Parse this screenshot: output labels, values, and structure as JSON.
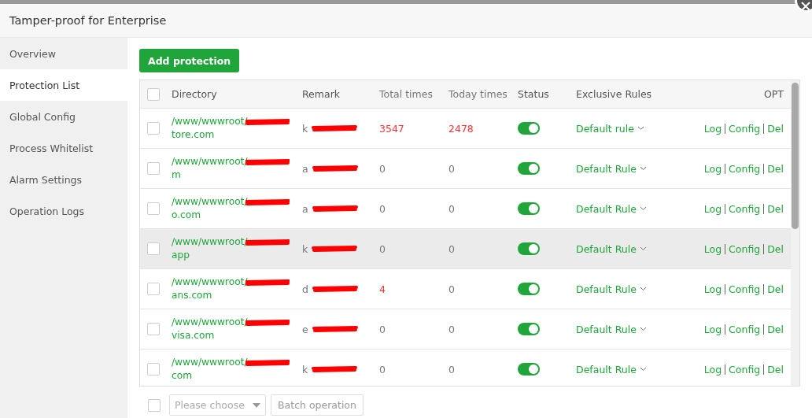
{
  "window": {
    "title": "Tamper-proof for Enterprise"
  },
  "sidebar": {
    "items": [
      {
        "label": "Overview",
        "selected": false
      },
      {
        "label": "Protection List",
        "selected": true
      },
      {
        "label": "Global Config",
        "selected": false
      },
      {
        "label": "Process Whitelist",
        "selected": false
      },
      {
        "label": "Alarm Settings",
        "selected": false
      },
      {
        "label": "Operation Logs",
        "selected": false
      }
    ]
  },
  "add_button": "Add protection",
  "table": {
    "all_checked": false,
    "columns": [
      "Directory",
      "Remark",
      "Total times",
      "Today times",
      "Status",
      "Exclusive Rules",
      "OPT"
    ],
    "rows": [
      {
        "dir_head": "/www/wwwroot/",
        "dir_tail": "tore.com",
        "remark_head": "k",
        "total": "3547",
        "total_alert": true,
        "today": "2478",
        "today_alert": true,
        "on": true,
        "rule": "Default rule",
        "actions": [
          "Log",
          "Config",
          "Del"
        ],
        "hovered": false,
        "checked": false
      },
      {
        "dir_head": "/www/wwwroot/",
        "dir_tail": "m",
        "remark_head": "a",
        "total": "0",
        "total_alert": false,
        "today": "0",
        "today_alert": false,
        "on": true,
        "rule": "Default Rule",
        "actions": [
          "Log",
          "Config",
          "Del"
        ],
        "hovered": false,
        "checked": false
      },
      {
        "dir_head": "/www/wwwroot/",
        "dir_tail": "o.com",
        "remark_head": "a",
        "total": "0",
        "total_alert": false,
        "today": "0",
        "today_alert": false,
        "on": true,
        "rule": "Default Rule",
        "actions": [
          "Log",
          "Config",
          "Del"
        ],
        "hovered": false,
        "checked": false
      },
      {
        "dir_head": "/www/wwwroot/",
        "dir_tail": "app",
        "remark_head": "k",
        "total": "0",
        "total_alert": false,
        "today": "0",
        "today_alert": false,
        "on": true,
        "rule": "Default Rule",
        "actions": [
          "Log",
          "Config",
          "Del"
        ],
        "hovered": true,
        "checked": false
      },
      {
        "dir_head": "/www/wwwroot/",
        "dir_tail": "ans.com",
        "remark_head": "d",
        "total": "4",
        "total_alert": true,
        "today": "0",
        "today_alert": false,
        "on": true,
        "rule": "Default Rule",
        "actions": [
          "Log",
          "Config",
          "Del"
        ],
        "hovered": false,
        "checked": false
      },
      {
        "dir_head": "/www/wwwroot/",
        "dir_tail": "visa.com",
        "remark_head": "e",
        "total": "0",
        "total_alert": false,
        "today": "0",
        "today_alert": false,
        "on": true,
        "rule": "Default Rule",
        "actions": [
          "Log",
          "Config",
          "Del"
        ],
        "hovered": false,
        "checked": false
      },
      {
        "dir_head": "/www/wwwroot/",
        "dir_tail": "com",
        "remark_head": "k",
        "total": "0",
        "total_alert": false,
        "today": "0",
        "today_alert": false,
        "on": true,
        "rule": "Default Rule",
        "actions": [
          "Log",
          "Config",
          "Del"
        ],
        "hovered": false,
        "checked": false
      }
    ]
  },
  "footer": {
    "checked": false,
    "select_placeholder": "Please choose",
    "batch_button": "Batch operation"
  }
}
